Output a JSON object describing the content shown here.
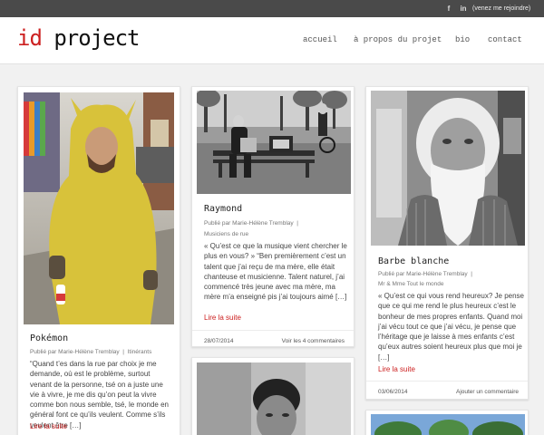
{
  "topbar": {
    "facebook_icon": "f",
    "linkedin_icon": "in",
    "join_label": "(venez me rejoindre)"
  },
  "header": {
    "logo_id": "id",
    "logo_project": "project",
    "nav": {
      "accueil": "accueil",
      "apropos": "à propos du projet",
      "bio": "bio",
      "contact": "contact"
    }
  },
  "posts": {
    "pokemon": {
      "title": "Pokémon",
      "meta_prefix": "Publié par",
      "author": "Marie-Hélène Tremblay",
      "category": "Itinérants",
      "excerpt": "“Quand t’es dans la rue par choix je me demande, où est le problème, surtout venant de la personne, tsé on a juste une vie à vivre, je me dis qu’on peut la vivre comme bon nous semble, tsé, le monde en général font ce qu’ils veulent. Comme s’ils veulent être […]",
      "more": "Lire la suite"
    },
    "raymond": {
      "title": "Raymond",
      "meta_prefix": "Publié par",
      "author": "Marie-Hélène Tremblay",
      "category": "Musiciens de rue",
      "excerpt": "« Qu’est ce que la musique vient chercher le plus en vous? » “Ben premièrement c’est un talent que j’ai reçu de ma mère, elle était chanteuse et musicienne. Talent naturel, j’ai commencé très jeune avec ma mère, ma mère m’a enseigné pis j’ai toujours aimé […]",
      "more": "Lire la suite",
      "date": "28/07/2014",
      "comments": "Voir les 4 commentaires"
    },
    "barbe": {
      "title": "Barbe blanche",
      "meta_prefix": "Publié par",
      "author": "Marie-Hélène Tremblay",
      "category": "Mr & Mme Tout le monde",
      "excerpt": "« Qu’est ce qui vous rend heureux? Je pense que ce qui me rend le plus heureux c’est le bonheur de mes propres enfants. Quand moi j’ai vécu tout ce que j’ai vécu, je pense que l’héritage que je laisse à mes enfants c’est qu’eux autres soient heureux plus que moi je […]",
      "more": "Lire la suite",
      "date": "03/06/2014",
      "comments": "Ajouter un commentaire"
    }
  },
  "colors": {
    "accent": "#cc1f1f",
    "topbar": "#4a4a4a"
  }
}
